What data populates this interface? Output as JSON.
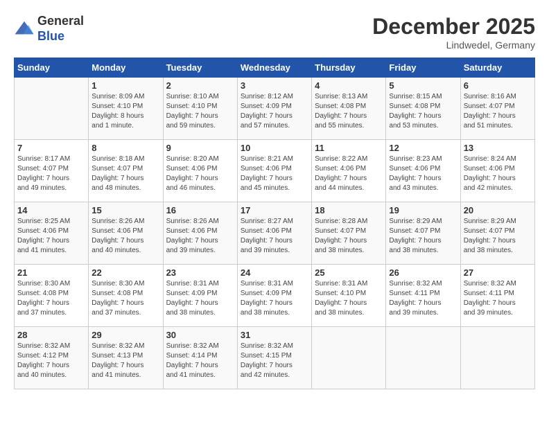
{
  "header": {
    "logo_line1": "General",
    "logo_line2": "Blue",
    "month_title": "December 2025",
    "location": "Lindwedel, Germany"
  },
  "weekdays": [
    "Sunday",
    "Monday",
    "Tuesday",
    "Wednesday",
    "Thursday",
    "Friday",
    "Saturday"
  ],
  "weeks": [
    [
      {
        "day": "",
        "info": ""
      },
      {
        "day": "1",
        "info": "Sunrise: 8:09 AM\nSunset: 4:10 PM\nDaylight: 8 hours\nand 1 minute."
      },
      {
        "day": "2",
        "info": "Sunrise: 8:10 AM\nSunset: 4:10 PM\nDaylight: 7 hours\nand 59 minutes."
      },
      {
        "day": "3",
        "info": "Sunrise: 8:12 AM\nSunset: 4:09 PM\nDaylight: 7 hours\nand 57 minutes."
      },
      {
        "day": "4",
        "info": "Sunrise: 8:13 AM\nSunset: 4:08 PM\nDaylight: 7 hours\nand 55 minutes."
      },
      {
        "day": "5",
        "info": "Sunrise: 8:15 AM\nSunset: 4:08 PM\nDaylight: 7 hours\nand 53 minutes."
      },
      {
        "day": "6",
        "info": "Sunrise: 8:16 AM\nSunset: 4:07 PM\nDaylight: 7 hours\nand 51 minutes."
      }
    ],
    [
      {
        "day": "7",
        "info": "Sunrise: 8:17 AM\nSunset: 4:07 PM\nDaylight: 7 hours\nand 49 minutes."
      },
      {
        "day": "8",
        "info": "Sunrise: 8:18 AM\nSunset: 4:07 PM\nDaylight: 7 hours\nand 48 minutes."
      },
      {
        "day": "9",
        "info": "Sunrise: 8:20 AM\nSunset: 4:06 PM\nDaylight: 7 hours\nand 46 minutes."
      },
      {
        "day": "10",
        "info": "Sunrise: 8:21 AM\nSunset: 4:06 PM\nDaylight: 7 hours\nand 45 minutes."
      },
      {
        "day": "11",
        "info": "Sunrise: 8:22 AM\nSunset: 4:06 PM\nDaylight: 7 hours\nand 44 minutes."
      },
      {
        "day": "12",
        "info": "Sunrise: 8:23 AM\nSunset: 4:06 PM\nDaylight: 7 hours\nand 43 minutes."
      },
      {
        "day": "13",
        "info": "Sunrise: 8:24 AM\nSunset: 4:06 PM\nDaylight: 7 hours\nand 42 minutes."
      }
    ],
    [
      {
        "day": "14",
        "info": "Sunrise: 8:25 AM\nSunset: 4:06 PM\nDaylight: 7 hours\nand 41 minutes."
      },
      {
        "day": "15",
        "info": "Sunrise: 8:26 AM\nSunset: 4:06 PM\nDaylight: 7 hours\nand 40 minutes."
      },
      {
        "day": "16",
        "info": "Sunrise: 8:26 AM\nSunset: 4:06 PM\nDaylight: 7 hours\nand 39 minutes."
      },
      {
        "day": "17",
        "info": "Sunrise: 8:27 AM\nSunset: 4:06 PM\nDaylight: 7 hours\nand 39 minutes."
      },
      {
        "day": "18",
        "info": "Sunrise: 8:28 AM\nSunset: 4:07 PM\nDaylight: 7 hours\nand 38 minutes."
      },
      {
        "day": "19",
        "info": "Sunrise: 8:29 AM\nSunset: 4:07 PM\nDaylight: 7 hours\nand 38 minutes."
      },
      {
        "day": "20",
        "info": "Sunrise: 8:29 AM\nSunset: 4:07 PM\nDaylight: 7 hours\nand 38 minutes."
      }
    ],
    [
      {
        "day": "21",
        "info": "Sunrise: 8:30 AM\nSunset: 4:08 PM\nDaylight: 7 hours\nand 37 minutes."
      },
      {
        "day": "22",
        "info": "Sunrise: 8:30 AM\nSunset: 4:08 PM\nDaylight: 7 hours\nand 37 minutes."
      },
      {
        "day": "23",
        "info": "Sunrise: 8:31 AM\nSunset: 4:09 PM\nDaylight: 7 hours\nand 38 minutes."
      },
      {
        "day": "24",
        "info": "Sunrise: 8:31 AM\nSunset: 4:09 PM\nDaylight: 7 hours\nand 38 minutes."
      },
      {
        "day": "25",
        "info": "Sunrise: 8:31 AM\nSunset: 4:10 PM\nDaylight: 7 hours\nand 38 minutes."
      },
      {
        "day": "26",
        "info": "Sunrise: 8:32 AM\nSunset: 4:11 PM\nDaylight: 7 hours\nand 39 minutes."
      },
      {
        "day": "27",
        "info": "Sunrise: 8:32 AM\nSunset: 4:11 PM\nDaylight: 7 hours\nand 39 minutes."
      }
    ],
    [
      {
        "day": "28",
        "info": "Sunrise: 8:32 AM\nSunset: 4:12 PM\nDaylight: 7 hours\nand 40 minutes."
      },
      {
        "day": "29",
        "info": "Sunrise: 8:32 AM\nSunset: 4:13 PM\nDaylight: 7 hours\nand 41 minutes."
      },
      {
        "day": "30",
        "info": "Sunrise: 8:32 AM\nSunset: 4:14 PM\nDaylight: 7 hours\nand 41 minutes."
      },
      {
        "day": "31",
        "info": "Sunrise: 8:32 AM\nSunset: 4:15 PM\nDaylight: 7 hours\nand 42 minutes."
      },
      {
        "day": "",
        "info": ""
      },
      {
        "day": "",
        "info": ""
      },
      {
        "day": "",
        "info": ""
      }
    ]
  ]
}
